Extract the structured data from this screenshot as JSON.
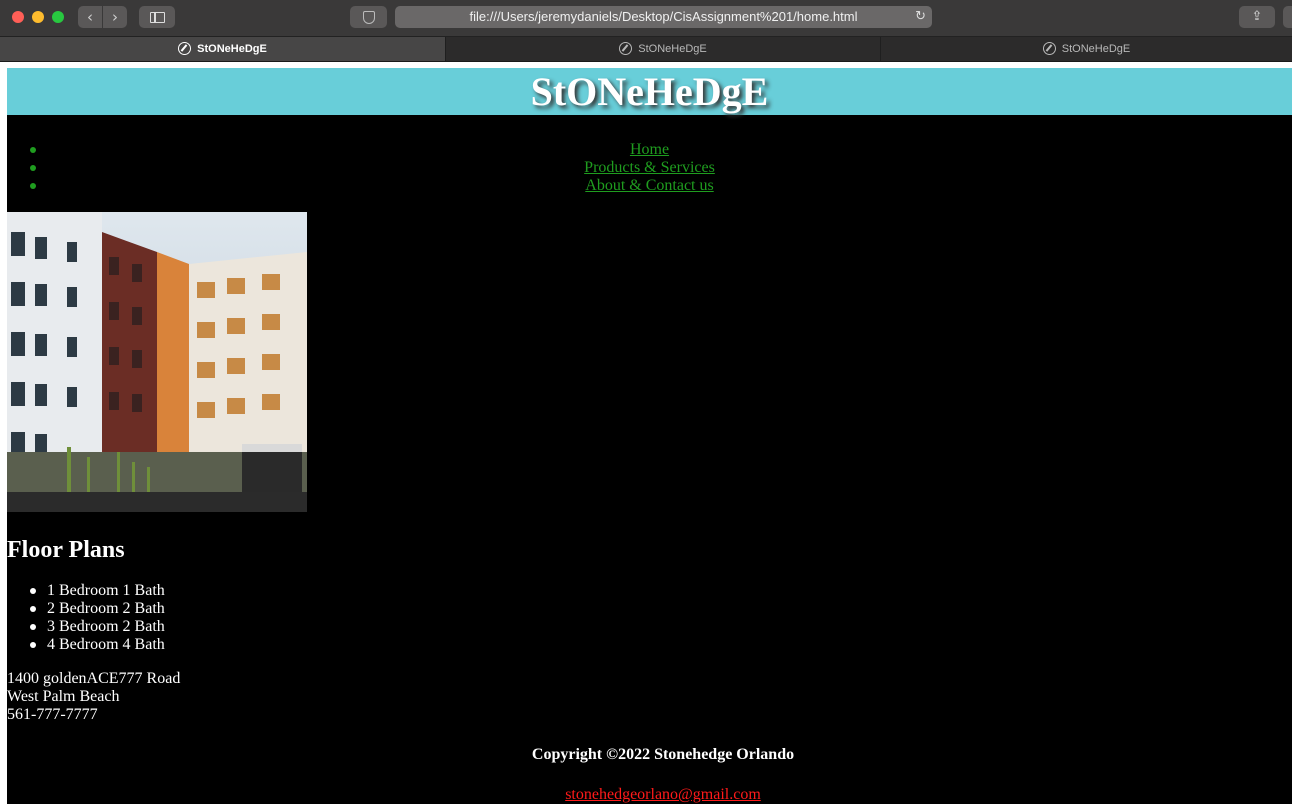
{
  "browser": {
    "address": "file:///Users/jeremydaniels/Desktop/CisAssignment%201/home.html",
    "tabs": [
      {
        "label": "StONeHeDgE",
        "active": true
      },
      {
        "label": "StONeHeDgE",
        "active": false
      },
      {
        "label": "StONeHeDgE",
        "active": false
      }
    ],
    "icons": {
      "back": "chevron-left-icon",
      "forward": "chevron-right-icon",
      "sidebar": "sidebar-icon",
      "privacy": "shield-icon",
      "reload": "reload-icon",
      "share": "share-icon",
      "tab": "compass-icon"
    }
  },
  "site": {
    "title": "StONeHeDgE",
    "banner_color": "#68ced9",
    "background": "#000000",
    "link_color": "#1f9d1f",
    "nav": [
      {
        "label": "Home"
      },
      {
        "label": "Products & Services"
      },
      {
        "label": "About & Contact us"
      }
    ],
    "image": {
      "description_icon": "apartment-building-photo"
    },
    "floor_plans": {
      "heading": "Floor Plans",
      "items": [
        "1 Bedroom 1 Bath",
        "2 Bedroom 2 Bath",
        "3 Bedroom 2 Bath",
        "4 Bedroom 4 Bath"
      ]
    },
    "address": {
      "line1": "1400 goldenACE777 Road",
      "line2": "West Palm Beach",
      "phone": "561-777-7777"
    },
    "footer": {
      "copyright": "Copyright ©2022 Stonehedge Orlando",
      "email": "stonehedgeorlano@gmail.com",
      "email_color": "#ff1a1a"
    }
  }
}
